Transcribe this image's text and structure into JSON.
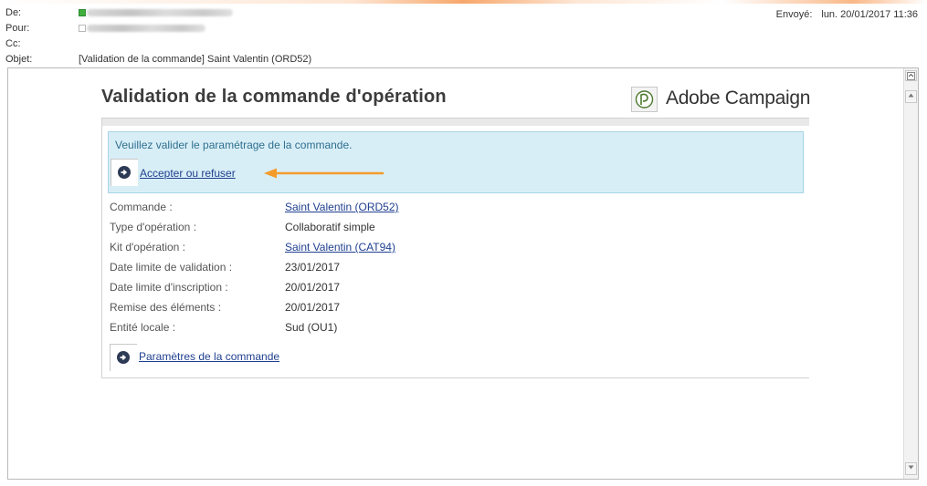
{
  "header": {
    "from_label": "De:",
    "to_label": "Pour:",
    "cc_label": "Cc:",
    "subject_label": "Objet:",
    "subject": "[Validation de la commande] Saint Valentin (ORD52)",
    "sent_label": "Envoyé:",
    "sent_value": "lun. 20/01/2017 11:36"
  },
  "message": {
    "title": "Validation de la commande d'opération",
    "brand": "Adobe Campaign",
    "notice": "Veuillez valider le paramétrage de la commande.",
    "action_link": "Accepter ou refuser",
    "fields": [
      {
        "label": "Commande :",
        "value": "Saint Valentin (ORD52)",
        "link": true
      },
      {
        "label": "Type d'opération :",
        "value": "Collaboratif simple",
        "link": false
      },
      {
        "label": "Kit d'opération :",
        "value": "Saint Valentin (CAT94)",
        "link": true
      },
      {
        "label": "Date limite de validation :",
        "value": "23/01/2017",
        "link": false
      },
      {
        "label": "Date limite d'inscription :",
        "value": "20/01/2017",
        "link": false
      },
      {
        "label": "Remise des éléments :",
        "value": "20/01/2017",
        "link": false
      },
      {
        "label": "Entité locale :",
        "value": "Sud (OU1)",
        "link": false
      }
    ],
    "params_link": "Paramètres de la commande"
  },
  "colors": {
    "notice_bg": "#d8eef6",
    "link": "#1f3f8f",
    "callout_arrow": "#f39b2b"
  },
  "icons": [
    "checkbox-icon",
    "arrow-right-circle-icon",
    "adobe-campaign-logo",
    "scroll-up-icon",
    "scroll-down-icon",
    "callout-arrow-icon"
  ]
}
